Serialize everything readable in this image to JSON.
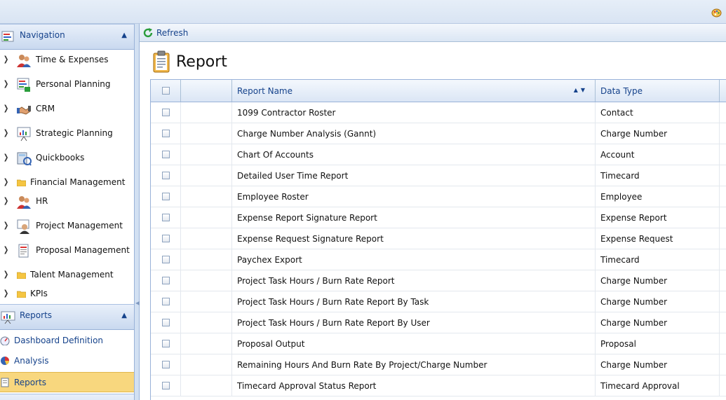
{
  "colors": {
    "accent": "#15428b",
    "selected": "#f8d77e",
    "border": "#99b2d8"
  },
  "navigation": {
    "title": "Navigation",
    "items": [
      {
        "label": "Time & Expenses",
        "icon": "people-icon"
      },
      {
        "label": "Personal Planning",
        "icon": "planner-icon"
      },
      {
        "label": "CRM",
        "icon": "handshake-icon"
      },
      {
        "label": "Strategic Planning",
        "icon": "presentation-icon"
      },
      {
        "label": "Quickbooks",
        "icon": "calculator-icon"
      },
      {
        "label": "Financial Management",
        "icon": "folder-icon"
      },
      {
        "label": "HR",
        "icon": "people-icon"
      },
      {
        "label": "Project Management",
        "icon": "person-board-icon"
      },
      {
        "label": "Proposal Management",
        "icon": "document-icon"
      },
      {
        "label": "Talent Management",
        "icon": "folder-icon"
      },
      {
        "label": "KPIs",
        "icon": "folder-icon"
      }
    ]
  },
  "reports_section": {
    "title": "Reports",
    "items": [
      {
        "label": "Dashboard Definition",
        "icon": "dashboard-icon"
      },
      {
        "label": "Analysis",
        "icon": "pie-chart-icon"
      },
      {
        "label": "Reports",
        "icon": "report-icon",
        "selected": true
      }
    ]
  },
  "toolbar": {
    "refresh_label": "Refresh"
  },
  "page": {
    "title": "Report"
  },
  "grid": {
    "columns": [
      "Report Name",
      "Data Type"
    ],
    "rows": [
      {
        "name": "1099 Contractor Roster",
        "type": "Contact"
      },
      {
        "name": "Charge Number Analysis (Gannt)",
        "type": "Charge Number"
      },
      {
        "name": "Chart Of Accounts",
        "type": "Account"
      },
      {
        "name": "Detailed User Time Report",
        "type": "Timecard"
      },
      {
        "name": "Employee Roster",
        "type": "Employee"
      },
      {
        "name": "Expense Report Signature Report",
        "type": "Expense Report"
      },
      {
        "name": "Expense Request Signature Report",
        "type": "Expense Request"
      },
      {
        "name": "Paychex Export",
        "type": "Timecard"
      },
      {
        "name": "Project Task Hours / Burn Rate Report",
        "type": "Charge Number"
      },
      {
        "name": "Project Task Hours / Burn Rate Report By Task",
        "type": "Charge Number"
      },
      {
        "name": "Project Task Hours / Burn Rate Report By User",
        "type": "Charge Number"
      },
      {
        "name": "Proposal Output",
        "type": "Proposal"
      },
      {
        "name": "Remaining Hours And Burn Rate By Project/Charge Number",
        "type": "Charge Number"
      },
      {
        "name": "Timecard Approval Status Report",
        "type": "Timecard Approval"
      }
    ]
  }
}
